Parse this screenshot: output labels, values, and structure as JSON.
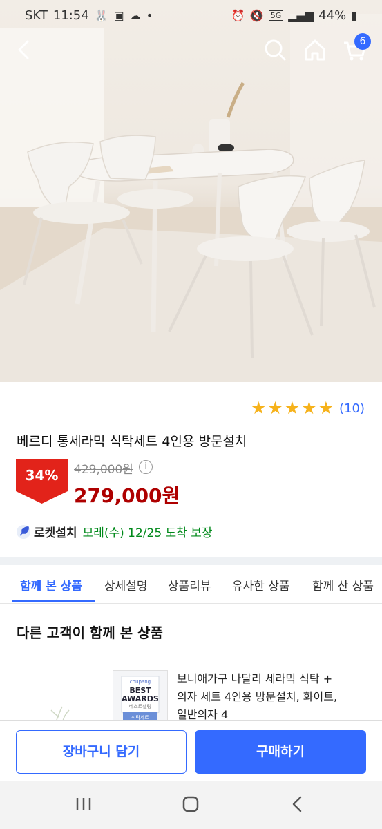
{
  "status_bar": {
    "carrier": "SKT",
    "time": "11:54",
    "network": "5G",
    "battery": "44%"
  },
  "header": {
    "cart_count": "6"
  },
  "product": {
    "rating_count": "(10)",
    "stars": 5,
    "title": "베르디 통세라믹 식탁세트 4인용 방문설치",
    "discount": "34%",
    "original_price": "429,000원",
    "sale_price": "279,000원",
    "delivery_brand": "로켓설치",
    "delivery_date": "모레(수) 12/25 도착 보장"
  },
  "tabs": [
    {
      "label": "함께 본 상품",
      "active": true
    },
    {
      "label": "상세설명",
      "active": false
    },
    {
      "label": "상품리뷰",
      "active": false
    },
    {
      "label": "유사한 상품",
      "active": false
    },
    {
      "label": "함께 산 상품",
      "active": false
    }
  ],
  "recommend": {
    "section_title": "다른 고객이 함께 본 상품",
    "item_badge_brand": "coupang",
    "item_badge_title_1": "BEST",
    "item_badge_title_2": "AWARDS",
    "item_badge_sub": "베스트셀링",
    "item_badge_category": "식탁세트",
    "item_title_line1": "보니애가구 나탈리 세라믹 식탁 +",
    "item_title_line2": "의자 세트 4인용 방문설치, 화이트,",
    "item_title_line3": "일반의자 4"
  },
  "actions": {
    "add_to_cart": "장바구니 담기",
    "buy_now": "구매하기"
  },
  "colors": {
    "accent": "#346aff",
    "sale_red": "#ae0000",
    "discount_badge": "#e2231a",
    "star": "#f6b21b",
    "delivery_green": "#00891a"
  }
}
